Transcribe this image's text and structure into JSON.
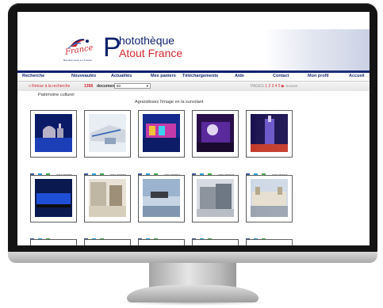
{
  "header": {
    "logo_word": "France",
    "logo_tagline": "Rendez-vous en France",
    "brand_initial": "P",
    "brand_line1": "hotothèque",
    "brand_line2": "Atout France"
  },
  "nav": {
    "items": [
      "Recherche",
      "Nouveautés",
      "Actualités",
      "Mes paniers",
      "Téléchargements",
      "Aide",
      "Contact",
      "Mon profil",
      "Accueil"
    ]
  },
  "toolbar": {
    "back_label": "« Retour à la recherche",
    "result_count": "1398",
    "result_label": "documents",
    "per_page_value": "60",
    "pages_label": "PAGES",
    "page_numbers": "1 2 3 4 5",
    "next_label": "Suivant"
  },
  "section": {
    "title": "Patrimoine culturel",
    "hint": "Agrandissez l'image en la survolant"
  },
  "results": [
    {
      "id": "20149079"
    },
    {
      "id": "20149073"
    },
    {
      "id": "20149004"
    },
    {
      "id": "20149062"
    },
    {
      "id": "20149051"
    },
    {
      "id": "20149050"
    },
    {
      "id": "20149044"
    },
    {
      "id": "20149042"
    },
    {
      "id": "20149041"
    },
    {
      "id": "20149037"
    }
  ],
  "icons": {
    "share_facebook": "facebook-icon",
    "share_twitter": "twitter-icon",
    "download": "download-icon"
  },
  "colors": {
    "brand_navy": "#0c1f6d",
    "brand_red": "#d1282f"
  }
}
